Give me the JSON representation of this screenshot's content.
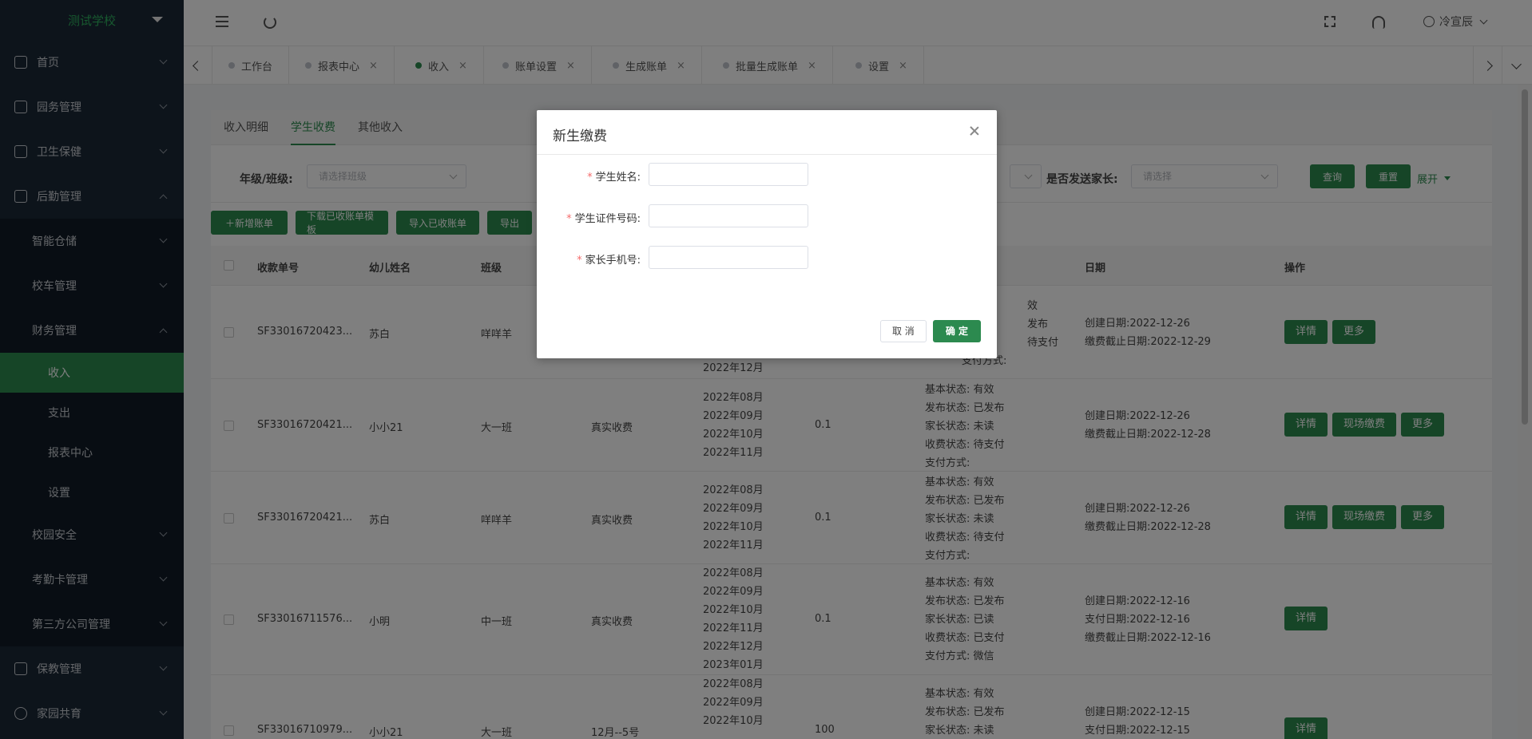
{
  "sidebar": {
    "school_name": "测试学校",
    "items": [
      {
        "label": "首页"
      },
      {
        "label": "园务管理"
      },
      {
        "label": "卫生保健"
      },
      {
        "label": "后勤管理"
      }
    ],
    "logistics_sub": [
      {
        "label": "智能仓储"
      },
      {
        "label": "校车管理"
      },
      {
        "label": "财务管理"
      }
    ],
    "finance_sub": [
      {
        "label": "收入"
      },
      {
        "label": "支出"
      },
      {
        "label": "报表中心"
      },
      {
        "label": "设置"
      }
    ],
    "logistics_sub2": [
      {
        "label": "校园安全"
      },
      {
        "label": "考勤卡管理"
      },
      {
        "label": "第三方公司管理"
      }
    ],
    "bottom_items": [
      {
        "label": "保教管理"
      },
      {
        "label": "家园共育"
      }
    ]
  },
  "header": {
    "user_name": "冷宣辰"
  },
  "tabs": [
    {
      "label": "工作台"
    },
    {
      "label": "报表中心",
      "close": "×"
    },
    {
      "label": "收入",
      "close": "×"
    },
    {
      "label": "账单设置",
      "close": "×"
    },
    {
      "label": "生成账单",
      "close": "×"
    },
    {
      "label": "批量生成账单",
      "close": "×"
    },
    {
      "label": "设置",
      "close": "×"
    }
  ],
  "subtabs": [
    {
      "label": "收入明细"
    },
    {
      "label": "学生收费"
    },
    {
      "label": "其他收入"
    }
  ],
  "filters": {
    "grade_label": "年级/班级:",
    "grade_placeholder": "请选择班级",
    "parent_label": "是否发送家长:",
    "parent_placeholder": "请选择",
    "query": "查询",
    "reset": "重置",
    "expand": "展开"
  },
  "actions": {
    "add": "＋新增账单",
    "download": "下载已收账单模板",
    "import": "导入已收账单",
    "export": "导出"
  },
  "table": {
    "headers": {
      "receipt_no": "收款单号",
      "child_name": "幼儿姓名",
      "class": "班级",
      "date": "日期",
      "op": "操作"
    },
    "rows": [
      {
        "receipt_no": "SF33016720423...",
        "child_name": "苏白",
        "class": "咩咩羊",
        "type": "",
        "months": [
          "2022年12月"
        ],
        "amount": "",
        "status": [
          "效",
          "发布",
          "待支付",
          "支付方式:"
        ],
        "dates": [
          "创建日期:2022-12-26",
          "缴费截止日期:2022-12-29"
        ],
        "buttons": [
          "详情",
          "更多"
        ]
      },
      {
        "receipt_no": "SF33016720421...",
        "child_name": "小小21",
        "class": "大一班",
        "type": "真实收费",
        "months": [
          "2022年08月",
          "2022年09月",
          "2022年10月",
          "2022年11月"
        ],
        "amount": "0.1",
        "status": [
          "基本状态: 有效",
          "发布状态: 已发布",
          "家长状态:  未读",
          "收费状态:  待支付",
          "支付方式:"
        ],
        "dates": [
          "创建日期:2022-12-26",
          "缴费截止日期:2022-12-28"
        ],
        "buttons": [
          "详情",
          "现场缴费",
          "更多"
        ]
      },
      {
        "receipt_no": "SF33016720421...",
        "child_name": "苏白",
        "class": "咩咩羊",
        "type": "真实收费",
        "months": [
          "2022年08月",
          "2022年09月",
          "2022年10月",
          "2022年11月"
        ],
        "amount": "0.1",
        "status": [
          "基本状态: 有效",
          "发布状态: 已发布",
          "家长状态:  未读",
          "收费状态:  待支付",
          "支付方式:"
        ],
        "dates": [
          "创建日期:2022-12-26",
          "缴费截止日期:2022-12-28"
        ],
        "buttons": [
          "详情",
          "现场缴费",
          "更多"
        ]
      },
      {
        "receipt_no": "SF33016711576...",
        "child_name": "小明",
        "class": "中一班",
        "type": "真实收费",
        "months": [
          "2022年08月",
          "2022年09月",
          "2022年10月",
          "2022年11月",
          "2022年12月",
          "2023年01月"
        ],
        "amount": "0.1",
        "status": [
          "基本状态: 有效",
          "发布状态: 已发布",
          "家长状态:  已读",
          "收费状态:  已支付",
          "支付方式:  微信"
        ],
        "dates": [
          "创建日期:2022-12-16",
          "支付日期:2022-12-16",
          "缴费截止日期:2022-12-16"
        ],
        "buttons": [
          "详情"
        ]
      },
      {
        "receipt_no": "SF33016710979...",
        "child_name": "小小21",
        "class": "大一班",
        "type": "12月--5号",
        "months": [
          "2022年08月",
          "2022年09月",
          "2022年10月"
        ],
        "amount": "100",
        "status": [
          "基本状态: 有效",
          "发布状态: 已发布",
          "家长状态:  未读"
        ],
        "dates": [
          "创建日期:2022-12-15",
          "支付日期:2022-12-15"
        ],
        "buttons": [
          "详情"
        ]
      }
    ]
  },
  "dialog": {
    "title": "新生缴费",
    "fields": [
      {
        "label": "学生姓名:",
        "required": "*",
        "value": ""
      },
      {
        "label": "学生证件号码:",
        "required": "*",
        "value": ""
      },
      {
        "label": "家长手机号:",
        "required": "*",
        "value": ""
      }
    ],
    "cancel": "取 消",
    "confirm": "确 定"
  }
}
